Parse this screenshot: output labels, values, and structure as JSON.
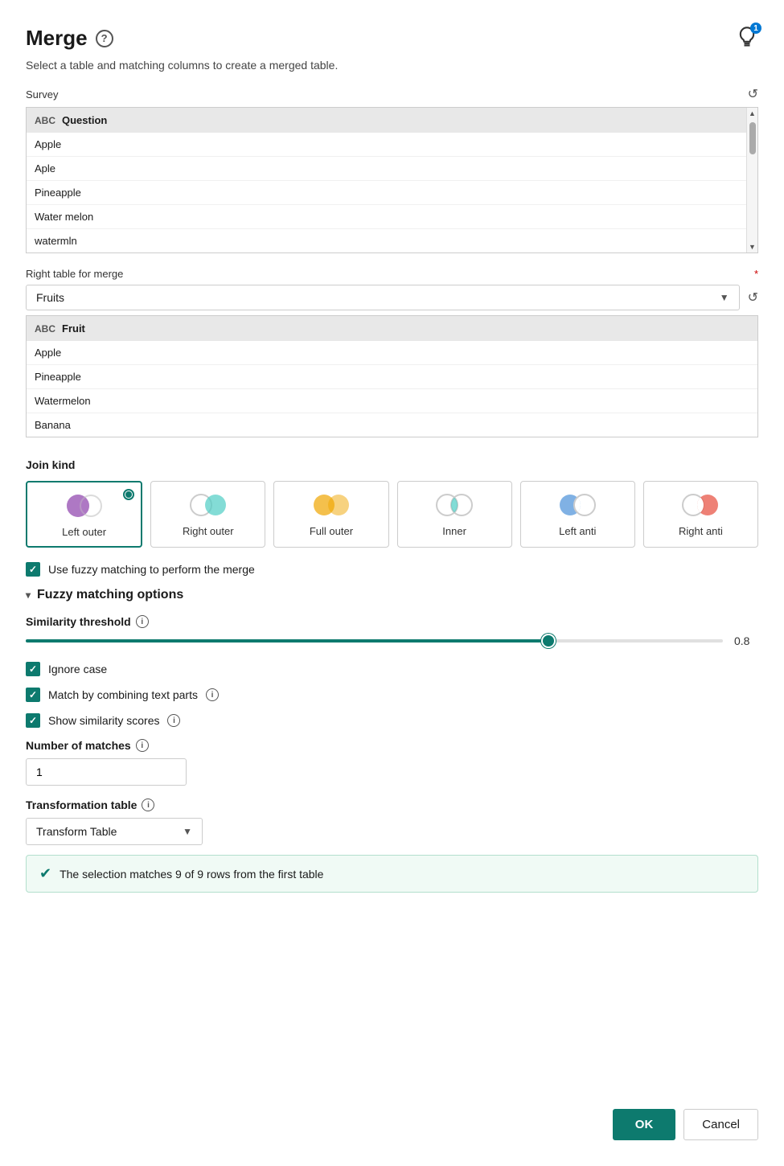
{
  "dialog": {
    "title": "Merge",
    "subtitle": "Select a table and matching columns to create a merged table.",
    "help_icon_label": "?",
    "tip_badge": "1"
  },
  "left_table": {
    "label": "Survey",
    "column": "Question",
    "rows": [
      "Apple",
      "Aple",
      "Pineapple",
      "Water melon",
      "watermln"
    ]
  },
  "right_table": {
    "label": "Right table for merge",
    "dropdown_value": "Fruits",
    "column": "Fruit",
    "rows": [
      "Apple",
      "Pineapple",
      "Watermelon",
      "Banana"
    ]
  },
  "join_kind": {
    "label": "Join kind",
    "options": [
      {
        "id": "left-outer",
        "label": "Left outer",
        "selected": true
      },
      {
        "id": "right-outer",
        "label": "Right outer",
        "selected": false
      },
      {
        "id": "full-outer",
        "label": "Full outer",
        "selected": false
      },
      {
        "id": "inner",
        "label": "Inner",
        "selected": false
      },
      {
        "id": "left-anti",
        "label": "Left anti",
        "selected": false
      },
      {
        "id": "right-anti",
        "label": "Right anti",
        "selected": false
      }
    ]
  },
  "fuzzy_checkbox": {
    "label": "Use fuzzy matching to perform the merge",
    "checked": true
  },
  "fuzzy_options": {
    "header": "Fuzzy matching options",
    "expanded": true,
    "similarity_threshold": {
      "label": "Similarity threshold",
      "value": 0.8,
      "percent": 75
    },
    "ignore_case": {
      "label": "Ignore case",
      "checked": true
    },
    "match_by_combining": {
      "label": "Match by combining text parts",
      "checked": true
    },
    "show_similarity": {
      "label": "Show similarity scores",
      "checked": true
    },
    "number_of_matches": {
      "label": "Number of matches",
      "value": "1"
    },
    "transformation_table": {
      "label": "Transformation table",
      "value": "Transform Table"
    }
  },
  "status": {
    "text": "The selection matches 9 of 9 rows from the first table"
  },
  "footer": {
    "ok_label": "OK",
    "cancel_label": "Cancel"
  }
}
